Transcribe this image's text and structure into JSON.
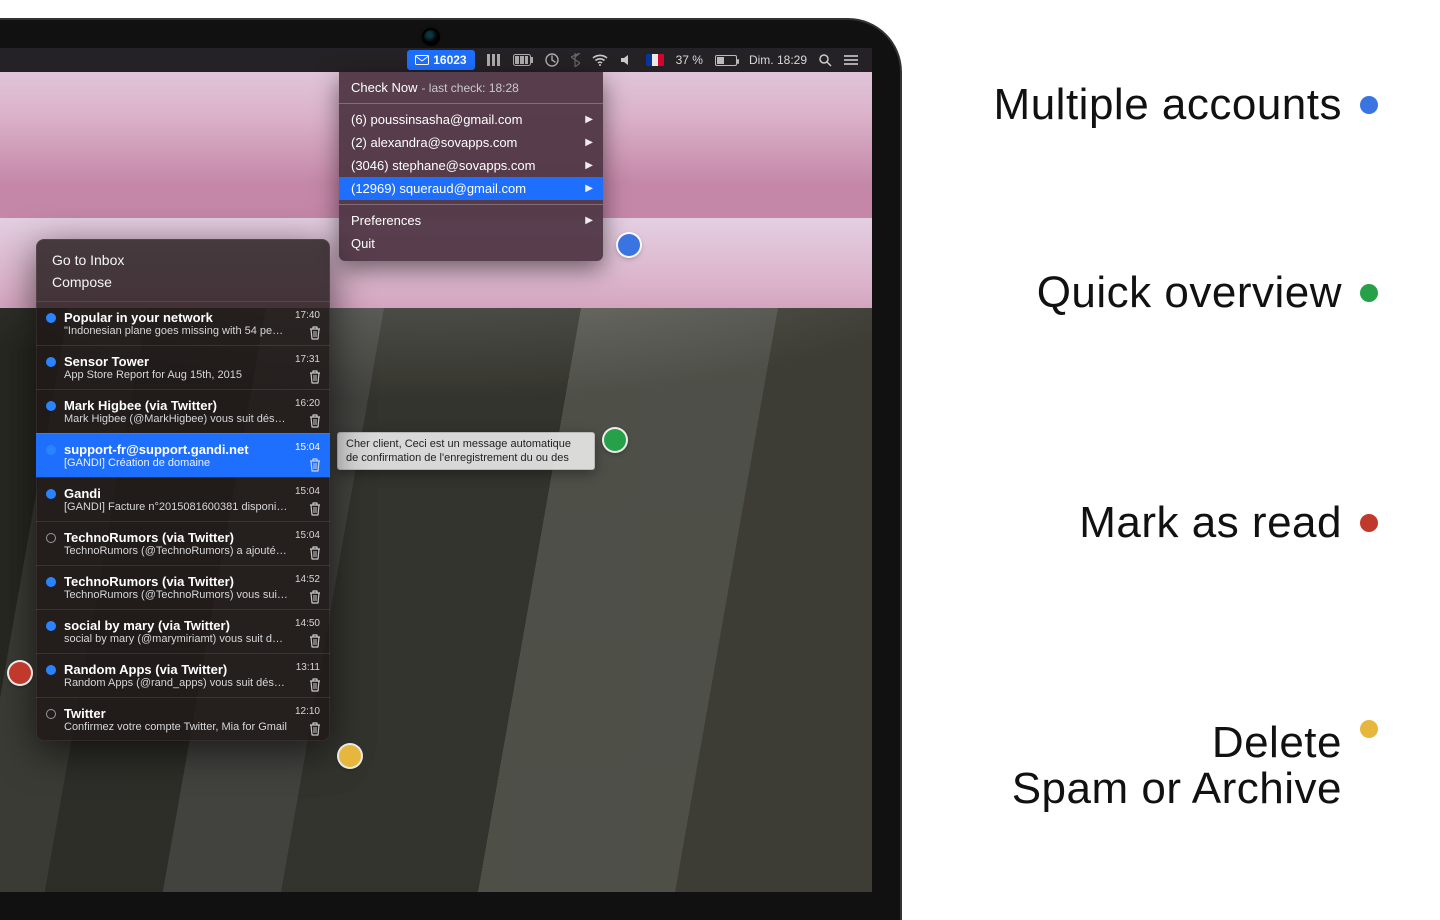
{
  "menubar": {
    "mail_count": "16023",
    "battery_pct": "37 %",
    "clock": "Dim. 18:29"
  },
  "account_menu": {
    "check_now_label": "Check Now",
    "last_check_text": "- last check: 18:28",
    "accounts": [
      {
        "display": "(6) poussinsasha@gmail.com"
      },
      {
        "display": "(2) alexandra@sovapps.com"
      },
      {
        "display": "(3046) stephane@sovapps.com"
      },
      {
        "display": "(12969) squeraud@gmail.com",
        "selected": true
      }
    ],
    "preferences_label": "Preferences",
    "quit_label": "Quit"
  },
  "tooltip_text": "Cher client, Ceci est un message automatique de confirmation de l'enregistrement du ou des",
  "popover": {
    "go_to_inbox": "Go to Inbox",
    "compose": "Compose"
  },
  "messages": [
    {
      "sender": "Popular in your network",
      "subject": "\"Indonesian plane goes missing with 54 peo…",
      "time": "17:40",
      "unread": true
    },
    {
      "sender": "Sensor Tower",
      "subject": "App Store Report for Aug 15th, 2015",
      "time": "17:31",
      "unread": true
    },
    {
      "sender": "Mark Higbee (via Twitter)",
      "subject": "Mark Higbee (@MarkHigbee) vous suit désor…",
      "time": "16:20",
      "unread": true
    },
    {
      "sender": "support-fr@support.gandi.net",
      "subject": "[GANDI] Création de domaine",
      "time": "15:04",
      "unread": true,
      "selected": true
    },
    {
      "sender": "Gandi",
      "subject": "[GANDI] Facture n°2015081600381 disponible",
      "time": "15:04",
      "unread": true
    },
    {
      "sender": "TechnoRumors (via Twitter)",
      "subject": "TechnoRumors (@TechnoRumors) a ajouté un…",
      "time": "15:04",
      "unread": false
    },
    {
      "sender": "TechnoRumors (via Twitter)",
      "subject": "TechnoRumors (@TechnoRumors) vous suit d…",
      "time": "14:52",
      "unread": true
    },
    {
      "sender": "social by mary (via Twitter)",
      "subject": "social by mary (@marymiriamt) vous suit dés…",
      "time": "14:50",
      "unread": true
    },
    {
      "sender": "Random Apps (via Twitter)",
      "subject": "Random Apps (@rand_apps) vous suit désor…",
      "time": "13:11",
      "unread": true
    },
    {
      "sender": "Twitter",
      "subject": "Confirmez votre compte Twitter, Mia for Gmail",
      "time": "12:10",
      "unread": false
    }
  ],
  "callouts": {
    "multi": {
      "text": "Multiple accounts",
      "color": "#3a74e0"
    },
    "quick": {
      "text": "Quick overview",
      "color": "#27a04a"
    },
    "read": {
      "text": "Mark as read",
      "color": "#c0392b"
    },
    "delete_l1": "Delete",
    "delete_l2": "Spam or Archive",
    "delete_color": "#e6b73c"
  }
}
